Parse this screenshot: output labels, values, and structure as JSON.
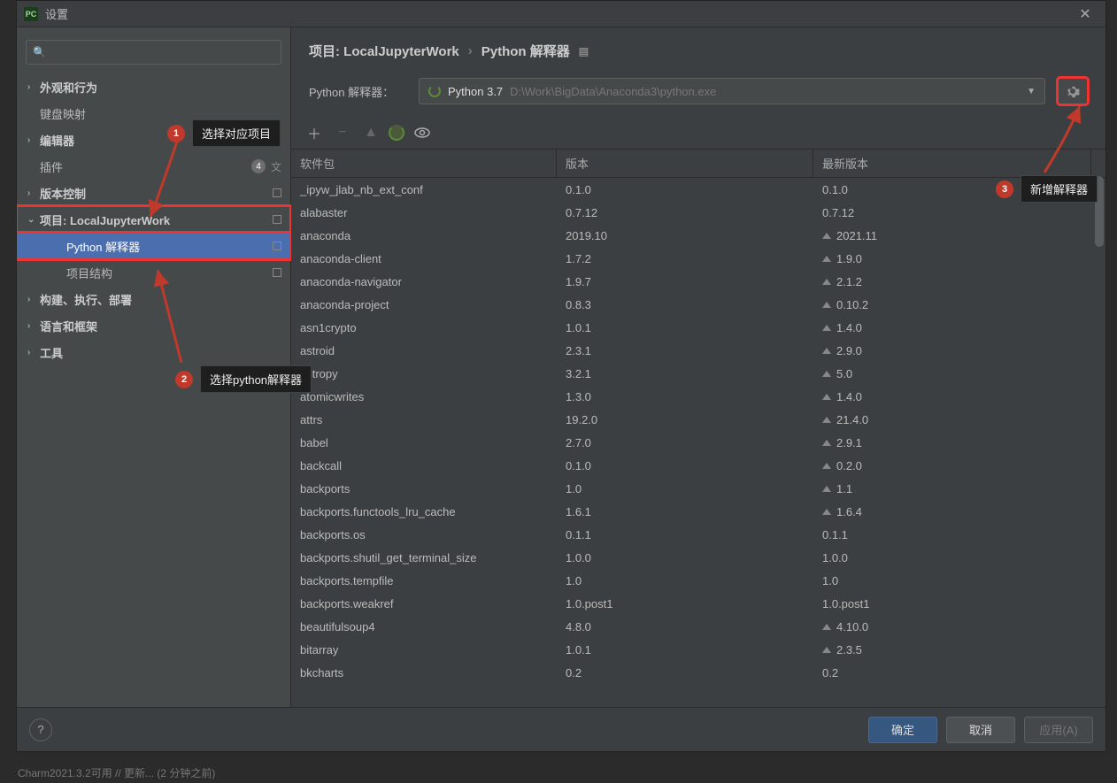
{
  "window": {
    "title": "设置",
    "close": "✕"
  },
  "sidebar": {
    "search_placeholder": "",
    "items": [
      {
        "label": "外观和行为",
        "expander": "›",
        "bold": true
      },
      {
        "label": "键盘映射",
        "expander": "",
        "bold": false
      },
      {
        "label": "编辑器",
        "expander": "›",
        "bold": true
      },
      {
        "label": "插件",
        "expander": "",
        "bold": false,
        "badge": "4"
      },
      {
        "label": "版本控制",
        "expander": "›",
        "bold": true
      },
      {
        "label": "项目: LocalJupyterWork",
        "expander": "⌄",
        "bold": true,
        "highlight": true
      },
      {
        "label": "Python 解释器",
        "child": true,
        "selected": true,
        "highlight": true
      },
      {
        "label": "项目结构",
        "child": true
      },
      {
        "label": "构建、执行、部署",
        "expander": "›",
        "bold": true
      },
      {
        "label": "语言和框架",
        "expander": "›",
        "bold": true
      },
      {
        "label": "工具",
        "expander": "›",
        "bold": true
      }
    ]
  },
  "breadcrumb": {
    "part1": "项目: LocalJupyterWork",
    "sep": "›",
    "part2": "Python 解释器"
  },
  "interp": {
    "label": "Python 解释器：",
    "name": "Python 3.7",
    "path": "D:\\Work\\BigData\\Anaconda3\\python.exe"
  },
  "table": {
    "headers": {
      "pkg": "软件包",
      "ver": "版本",
      "latest": "最新版本"
    }
  },
  "packages": [
    {
      "name": "_ipyw_jlab_nb_ext_conf",
      "ver": "0.1.0",
      "latest": "0.1.0",
      "up": false
    },
    {
      "name": "alabaster",
      "ver": "0.7.12",
      "latest": "0.7.12",
      "up": false
    },
    {
      "name": "anaconda",
      "ver": "2019.10",
      "latest": "2021.11",
      "up": true
    },
    {
      "name": "anaconda-client",
      "ver": "1.7.2",
      "latest": "1.9.0",
      "up": true
    },
    {
      "name": "anaconda-navigator",
      "ver": "1.9.7",
      "latest": "2.1.2",
      "up": true
    },
    {
      "name": "anaconda-project",
      "ver": "0.8.3",
      "latest": "0.10.2",
      "up": true
    },
    {
      "name": "asn1crypto",
      "ver": "1.0.1",
      "latest": "1.4.0",
      "up": true
    },
    {
      "name": "astroid",
      "ver": "2.3.1",
      "latest": "2.9.0",
      "up": true
    },
    {
      "name": "astropy",
      "ver": "3.2.1",
      "latest": "5.0",
      "up": true
    },
    {
      "name": "atomicwrites",
      "ver": "1.3.0",
      "latest": "1.4.0",
      "up": true
    },
    {
      "name": "attrs",
      "ver": "19.2.0",
      "latest": "21.4.0",
      "up": true
    },
    {
      "name": "babel",
      "ver": "2.7.0",
      "latest": "2.9.1",
      "up": true
    },
    {
      "name": "backcall",
      "ver": "0.1.0",
      "latest": "0.2.0",
      "up": true
    },
    {
      "name": "backports",
      "ver": "1.0",
      "latest": "1.1",
      "up": true
    },
    {
      "name": "backports.functools_lru_cache",
      "ver": "1.6.1",
      "latest": "1.6.4",
      "up": true
    },
    {
      "name": "backports.os",
      "ver": "0.1.1",
      "latest": "0.1.1",
      "up": false
    },
    {
      "name": "backports.shutil_get_terminal_size",
      "ver": "1.0.0",
      "latest": "1.0.0",
      "up": false
    },
    {
      "name": "backports.tempfile",
      "ver": "1.0",
      "latest": "1.0",
      "up": false
    },
    {
      "name": "backports.weakref",
      "ver": "1.0.post1",
      "latest": "1.0.post1",
      "up": false
    },
    {
      "name": "beautifulsoup4",
      "ver": "4.8.0",
      "latest": "4.10.0",
      "up": true
    },
    {
      "name": "bitarray",
      "ver": "1.0.1",
      "latest": "2.3.5",
      "up": true
    },
    {
      "name": "bkcharts",
      "ver": "0.2",
      "latest": "0.2",
      "up": false
    }
  ],
  "footer": {
    "help": "?",
    "ok": "确定",
    "cancel": "取消",
    "apply": "应用(A)"
  },
  "annotations": {
    "a1": {
      "num": "1",
      "text": "选择对应项目"
    },
    "a2": {
      "num": "2",
      "text": "选择python解释器"
    },
    "a3": {
      "num": "3",
      "text": "新增解释器"
    }
  },
  "statusbar": "Charm2021.3.2可用 // 更新... (2 分钟之前)"
}
